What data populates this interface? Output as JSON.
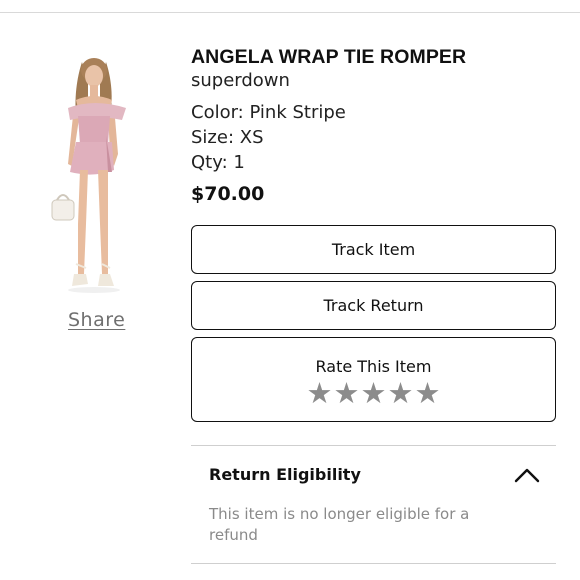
{
  "product": {
    "title": "ANGELA WRAP TIE ROMPER",
    "brand": "superdown",
    "color": "Color: Pink Stripe",
    "size": "Size: XS",
    "qty": "Qty: 1",
    "price": "$70.00",
    "image_icon": "product-photo-model-pink-romper"
  },
  "share_label": "Share",
  "actions": {
    "track_item": "Track Item",
    "track_return": "Track Return",
    "rate_label": "Rate This Item",
    "rating": 0,
    "star_glyph": "★"
  },
  "return_section": {
    "title": "Return Eligibility",
    "body": "This item is no longer eligible for a refund",
    "expanded": true,
    "toggle_icon": "chevron-up-icon"
  },
  "colors": {
    "star": "#8c8c8c",
    "border": "#111111",
    "muted_text": "#8a8a8a"
  }
}
